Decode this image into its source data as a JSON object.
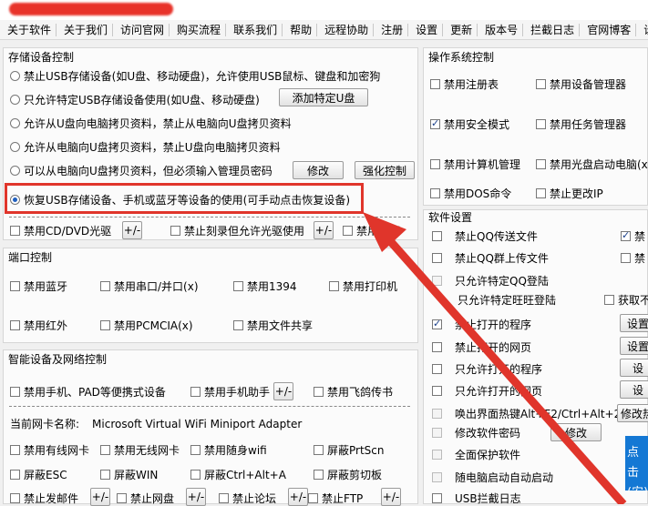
{
  "menu": [
    "关于软件",
    "关于我们",
    "访问官网",
    "购买流程",
    "联系我们",
    "帮助",
    "远程协助",
    "注册",
    "设置",
    "更新",
    "版本号",
    "拦截日志",
    "官网博客",
    "设"
  ],
  "storage": {
    "title": "存储设备控制",
    "options": [
      "禁止USB存储设备(如U盘、移动硬盘)，允许使用USB鼠标、键盘和加密狗",
      "只允许特定USB存储设备使用(如U盘、移动硬盘)",
      "允许从U盘向电脑拷贝资料，禁止从电脑向U盘拷贝资料",
      "允许从电脑向U盘拷贝资料，禁止U盘向电脑拷贝资料",
      "可以从电脑向U盘拷贝资料，但必须输入管理员密码",
      "恢复USB存储设备、手机或蓝牙等设备的使用(可手动点击恢复设备)"
    ],
    "add_usb_button": "添加特定U盘",
    "modify_button": "修改",
    "enhance_button": "强化控制",
    "cd_disable": "禁用CD/DVD光驱",
    "pm": "+/-",
    "burn_disable": "禁止刻录但允许光驱使用",
    "floppy_disable": "禁用软驱"
  },
  "ports": {
    "title": "端口控制",
    "items": [
      "禁用蓝牙",
      "禁用串口/并口(x)",
      "禁用1394",
      "禁用打印机",
      "禁用红外",
      "禁用PCMCIA(x)",
      "禁用文件共享"
    ]
  },
  "smart": {
    "title": "智能设备及网络控制",
    "row1": [
      "禁用手机、PAD等便携式设备",
      "禁用手机助手",
      "禁用飞鸽传书"
    ],
    "nic_label": "当前网卡名称:",
    "nic_value": "Microsoft Virtual WiFi Miniport Adapter",
    "row2": [
      "禁用有线网卡",
      "禁用无线网卡",
      "禁用随身wifi",
      "屏蔽PrtScn"
    ],
    "row3": [
      "屏蔽ESC",
      "屏蔽WIN",
      "屏蔽Ctrl+Alt+A",
      "屏蔽剪切板"
    ],
    "row4": [
      "禁止发邮件",
      "禁止网盘",
      "禁止论坛",
      "禁止FTP"
    ]
  },
  "os": {
    "title": "操作系统控制",
    "items": [
      "禁用注册表",
      "禁用设备管理器",
      "禁用安全模式",
      "禁用任务管理器",
      "禁用计算机管理",
      "禁用光盘启动电脑(x)",
      "禁用DOS命令",
      "禁止更改IP"
    ]
  },
  "software": {
    "title": "软件设置",
    "items": [
      "禁止QQ传送文件",
      "禁止QQ群上传文件",
      "只允许特定QQ登陆",
      "只允许特定旺旺登陆",
      "禁止打开的程序",
      "禁止打开的网页",
      "只允许打开的程序",
      "只允许打开的网页",
      "唤出界面热键Alt+F2/Ctrl+Alt+2",
      "修改软件密码",
      "全面保护软件",
      "随电脑启动自动启动",
      "USB拦截日志"
    ],
    "right_items": [
      "禁",
      "禁",
      "获取不"
    ],
    "setting_button": "设置",
    "setting_short": "设",
    "modify_button": "修改",
    "hotkey_button": "修改热"
  },
  "side_banner": "点击 (安)"
}
